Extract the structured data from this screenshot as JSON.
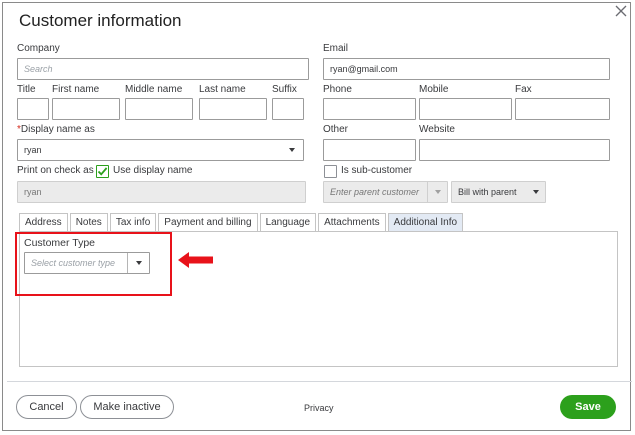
{
  "dialog": {
    "title": "Customer information",
    "close_icon": "close-icon",
    "accent_color": "#2ca01c"
  },
  "company": {
    "label": "Company",
    "placeholder": "Search"
  },
  "email": {
    "label": "Email",
    "value": "ryan@gmail.com"
  },
  "name_fields": {
    "title_label": "Title",
    "first_label": "First name",
    "middle_label": "Middle name",
    "last_label": "Last name",
    "suffix_label": "Suffix"
  },
  "phone": {
    "label": "Phone"
  },
  "mobile": {
    "label": "Mobile"
  },
  "fax": {
    "label": "Fax"
  },
  "display_name": {
    "required_mark": "*",
    "label": "Display name as",
    "value": "ryan"
  },
  "other": {
    "label": "Other"
  },
  "website": {
    "label": "Website"
  },
  "print_on_check": {
    "label": "Print on check as",
    "use_display_label": "Use display name",
    "use_display_checked": true,
    "value": "ryan"
  },
  "sub_customer": {
    "label": "Is sub-customer",
    "checked": false,
    "parent_placeholder": "Enter parent customer",
    "bill_with": "Bill with parent"
  },
  "tabs": [
    {
      "label": "Address",
      "active": false
    },
    {
      "label": "Notes",
      "active": false
    },
    {
      "label": "Tax info",
      "active": false
    },
    {
      "label": "Payment and billing",
      "active": false
    },
    {
      "label": "Language",
      "active": false
    },
    {
      "label": "Attachments",
      "active": false
    },
    {
      "label": "Additional Info",
      "active": true
    }
  ],
  "additional_info": {
    "customer_type_label": "Customer Type",
    "customer_type_placeholder": "Select customer type"
  },
  "annotation": {
    "highlight_color": "#e8121a",
    "arrow_icon": "left-arrow-icon"
  },
  "footer": {
    "cancel_label": "Cancel",
    "make_inactive_label": "Make inactive",
    "privacy_label": "Privacy",
    "save_label": "Save"
  }
}
